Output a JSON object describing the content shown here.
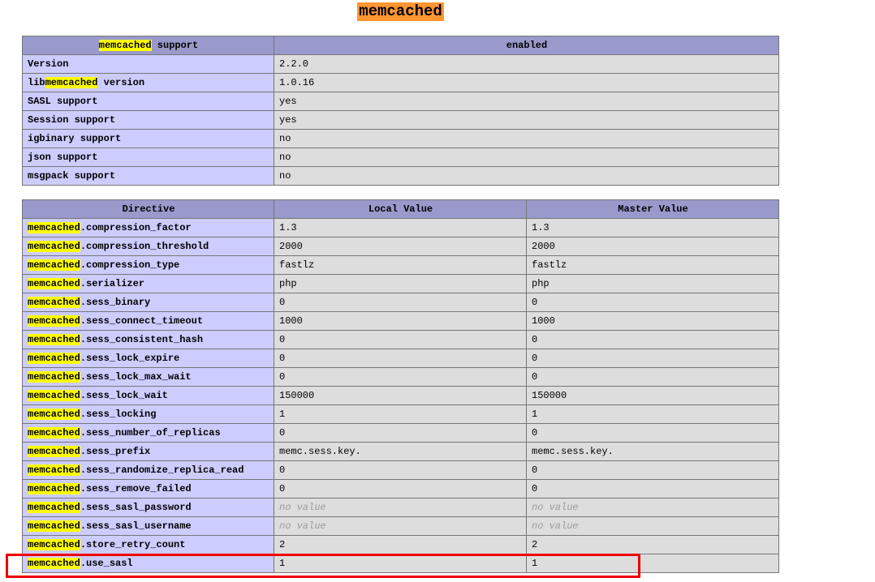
{
  "page": {
    "title": "memcached"
  },
  "colors": {
    "header_bg": "#9999cc",
    "label_bg": "#ccccff",
    "value_bg": "#dddddd",
    "cell_border": "#767676",
    "find_highlight_active": "#ff9632",
    "find_highlight_match": "#ffff00",
    "annotation_red": "#f00000",
    "no_value_text": "#9c9c9c"
  },
  "support_table": {
    "header": {
      "col1": {
        "pre": "",
        "hl": "memcached",
        "post": " support"
      },
      "col2": "enabled"
    },
    "rows": [
      {
        "label": {
          "pre": "Version",
          "hl": "",
          "post": ""
        },
        "value": "2.2.0"
      },
      {
        "label": {
          "pre": "lib",
          "hl": "memcached",
          "post": " version"
        },
        "value": "1.0.16"
      },
      {
        "label": {
          "pre": "SASL support",
          "hl": "",
          "post": ""
        },
        "value": "yes"
      },
      {
        "label": {
          "pre": "Session support",
          "hl": "",
          "post": ""
        },
        "value": "yes"
      },
      {
        "label": {
          "pre": "igbinary support",
          "hl": "",
          "post": ""
        },
        "value": "no"
      },
      {
        "label": {
          "pre": "json support",
          "hl": "",
          "post": ""
        },
        "value": "no"
      },
      {
        "label": {
          "pre": "msgpack support",
          "hl": "",
          "post": ""
        },
        "value": "no"
      }
    ]
  },
  "directives_table": {
    "headers": [
      "Directive",
      "Local Value",
      "Master Value"
    ],
    "rows": [
      {
        "name": {
          "pre": "",
          "hl": "memcached",
          "post": ".compression_factor"
        },
        "local": "1.3",
        "master": "1.3"
      },
      {
        "name": {
          "pre": "",
          "hl": "memcached",
          "post": ".compression_threshold"
        },
        "local": "2000",
        "master": "2000"
      },
      {
        "name": {
          "pre": "",
          "hl": "memcached",
          "post": ".compression_type"
        },
        "local": "fastlz",
        "master": "fastlz"
      },
      {
        "name": {
          "pre": "",
          "hl": "memcached",
          "post": ".serializer"
        },
        "local": "php",
        "master": "php"
      },
      {
        "name": {
          "pre": "",
          "hl": "memcached",
          "post": ".sess_binary"
        },
        "local": "0",
        "master": "0"
      },
      {
        "name": {
          "pre": "",
          "hl": "memcached",
          "post": ".sess_connect_timeout"
        },
        "local": "1000",
        "master": "1000"
      },
      {
        "name": {
          "pre": "",
          "hl": "memcached",
          "post": ".sess_consistent_hash"
        },
        "local": "0",
        "master": "0"
      },
      {
        "name": {
          "pre": "",
          "hl": "memcached",
          "post": ".sess_lock_expire"
        },
        "local": "0",
        "master": "0"
      },
      {
        "name": {
          "pre": "",
          "hl": "memcached",
          "post": ".sess_lock_max_wait"
        },
        "local": "0",
        "master": "0"
      },
      {
        "name": {
          "pre": "",
          "hl": "memcached",
          "post": ".sess_lock_wait"
        },
        "local": "150000",
        "master": "150000"
      },
      {
        "name": {
          "pre": "",
          "hl": "memcached",
          "post": ".sess_locking"
        },
        "local": "1",
        "master": "1"
      },
      {
        "name": {
          "pre": "",
          "hl": "memcached",
          "post": ".sess_number_of_replicas"
        },
        "local": "0",
        "master": "0"
      },
      {
        "name": {
          "pre": "",
          "hl": "memcached",
          "post": ".sess_prefix"
        },
        "local": "memc.sess.key.",
        "master": "memc.sess.key."
      },
      {
        "name": {
          "pre": "",
          "hl": "memcached",
          "post": ".sess_randomize_replica_read"
        },
        "local": "0",
        "master": "0"
      },
      {
        "name": {
          "pre": "",
          "hl": "memcached",
          "post": ".sess_remove_failed"
        },
        "local": "0",
        "master": "0"
      },
      {
        "name": {
          "pre": "",
          "hl": "memcached",
          "post": ".sess_sasl_password"
        },
        "local": "no value",
        "master": "no value"
      },
      {
        "name": {
          "pre": "",
          "hl": "memcached",
          "post": ".sess_sasl_username"
        },
        "local": "no value",
        "master": "no value"
      },
      {
        "name": {
          "pre": "",
          "hl": "memcached",
          "post": ".store_retry_count"
        },
        "local": "2",
        "master": "2"
      },
      {
        "name": {
          "pre": "",
          "hl": "memcached",
          "post": ".use_sasl"
        },
        "local": "1",
        "master": "1",
        "red_boxed": true
      }
    ]
  },
  "no_value_literal": "no value"
}
